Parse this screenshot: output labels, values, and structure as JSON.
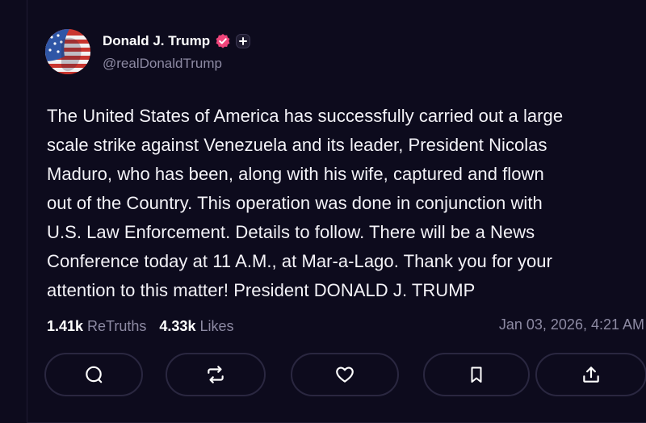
{
  "post": {
    "author": {
      "display_name": "Donald J. Trump",
      "handle": "@realDonaldTrump",
      "verified_icon": "verified-badge-icon",
      "verified_color": "#f0457b",
      "extra_icon": "plus-badge-icon"
    },
    "body_lines": [
      "The United States of America has successfully carried out a large",
      "scale strike against Venezuela and its leader, President Nicolas",
      "Maduro, who has been, along with his wife, captured and flown",
      "out of the Country. This operation was done in conjunction with",
      "U.S. Law Enforcement. Details to follow. There will be a News",
      "Conference today at 11 A.M., at Mar-a-Lago. Thank you for your",
      "attention to this matter! President DONALD J. TRUMP"
    ],
    "stats": {
      "retruths_count": "1.41k",
      "retruths_label": "ReTruths",
      "likes_count": "4.33k",
      "likes_label": "Likes"
    },
    "timestamp": "Jan 03, 2026, 4:21 AM",
    "actions": [
      {
        "name": "reply",
        "icon": "comment-icon"
      },
      {
        "name": "retruth",
        "icon": "repost-icon"
      },
      {
        "name": "like",
        "icon": "heart-icon"
      },
      {
        "name": "bookmark",
        "icon": "bookmark-icon"
      },
      {
        "name": "share",
        "icon": "share-icon"
      }
    ]
  },
  "colors": {
    "background": "#0d0b1d",
    "muted_text": "#8d8aa3",
    "button_border": "#2a2740"
  }
}
